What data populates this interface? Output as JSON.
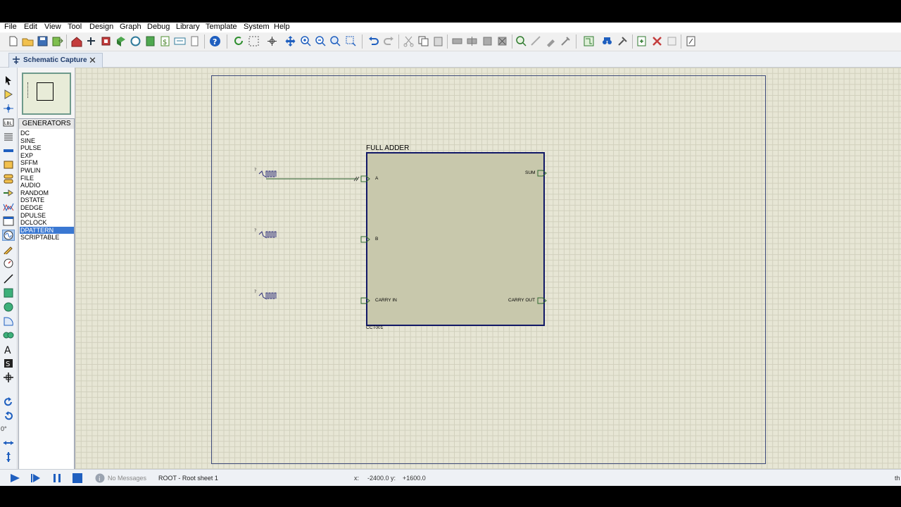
{
  "menu": [
    "File",
    "Edit",
    "View",
    "Tool",
    "Design",
    "Graph",
    "Debug",
    "Library",
    "Template",
    "System",
    "Help"
  ],
  "tab": {
    "title": "Schematic Capture",
    "close": "✕"
  },
  "left_tools": {
    "rotation": "0°"
  },
  "generators": {
    "header": "GENERATORS",
    "items": [
      "DC",
      "SINE",
      "PULSE",
      "EXP",
      "SFFM",
      "PWLIN",
      "FILE",
      "AUDIO",
      "RANDOM",
      "DSTATE",
      "DEDGE",
      "DPULSE",
      "DCLOCK",
      "DPATTERN",
      "SCRIPTABLE"
    ],
    "selected": "DPATTERN"
  },
  "schematic": {
    "component_title": "FULL ADDER",
    "component_ref": "CCT001",
    "pins": {
      "a": "A",
      "b": "B",
      "carry_in": "CARRY IN",
      "sum": "SUM",
      "carry_out": "CARRY OUT"
    },
    "generator_mark": "?"
  },
  "status": {
    "messages": "No Messages",
    "sheet": "ROOT - Root sheet 1",
    "x_label": "x:",
    "x_value": "-2400.0",
    "y_label": "y:",
    "y_value": "+1600.0",
    "trailing": "th"
  },
  "colors": {
    "accent": "#3a78d2",
    "component_fill": "#c8c8ac",
    "component_border": "#111866",
    "canvas": "#e7e6d5",
    "wire": "#4f7a4f"
  }
}
